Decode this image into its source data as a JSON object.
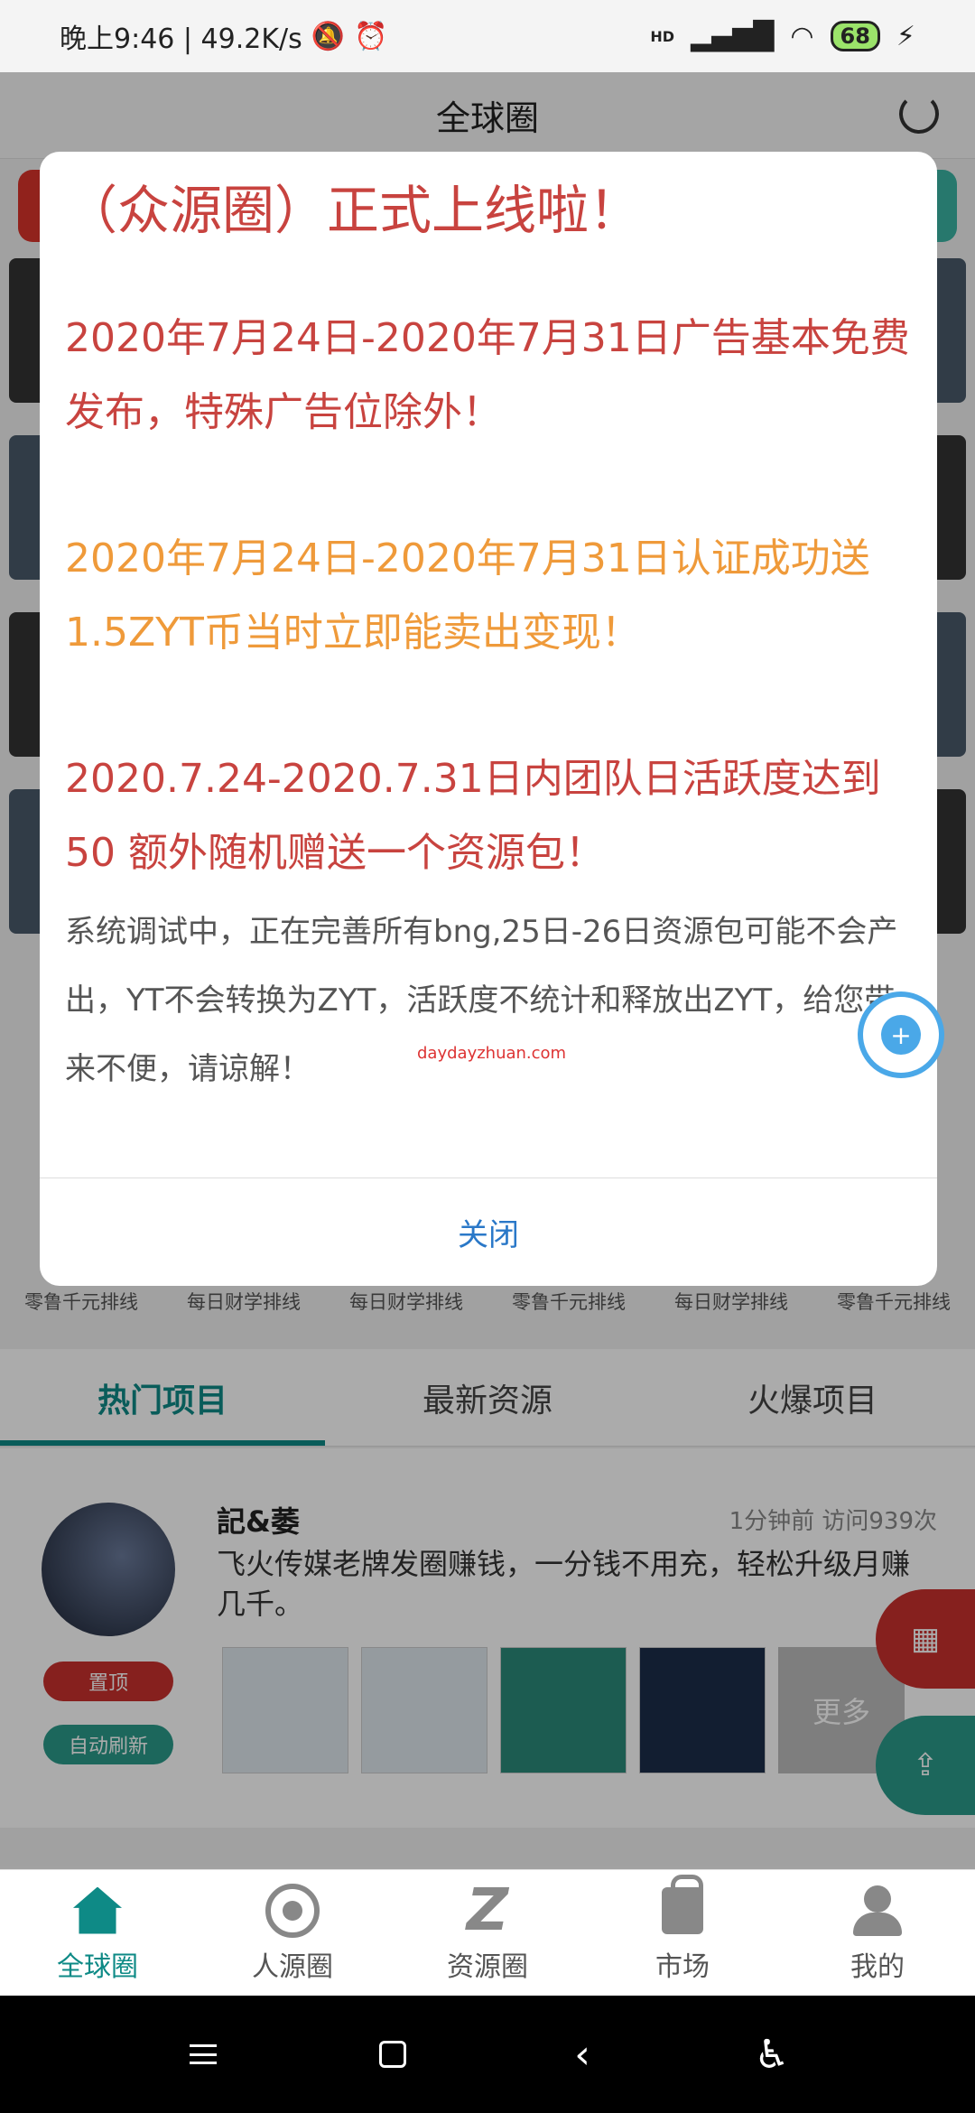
{
  "status_bar": {
    "time_speed": "晚上9:46 | 49.2K/s",
    "battery": "68",
    "signal_label": "HD"
  },
  "header": {
    "title": "全球圈"
  },
  "thumb_labels": [
    "零鲁千元排线",
    "每日财学排线",
    "每日财学排线",
    "零鲁千元排线",
    "每日财学排线",
    "零鲁千元排线"
  ],
  "tabs": [
    {
      "label": "热门项目",
      "active": true
    },
    {
      "label": "最新资源",
      "active": false
    },
    {
      "label": "火爆项目",
      "active": false
    }
  ],
  "post": {
    "author": "記&萎",
    "meta": "1分钟前   访问939次",
    "text": "飞火传媒老牌发圈赚钱，一分钱不用充，轻松升级月赚几千。",
    "pin_label": "置顶",
    "refresh_label": "自动刷新",
    "more_label": "更多"
  },
  "modal": {
    "title": "（众源圈）正式上线啦！",
    "para1": "2020年7月24日-2020年7月31日广告基本免费发布，特殊广告位除外！",
    "para2": "2020年7月24日-2020年7月31日认证成功送1.5ZYT币当时立即能卖出变现！",
    "para3": "2020.7.24-2020.7.31日内团队日活跃度达到50 额外随机赠送一个资源包！",
    "note": "系统调试中，正在完善所有bng,25日-26日资源包可能不会产出，YT不会转换为ZYT，活跃度不统计和释放出ZYT，给您带来不便，请谅解！",
    "watermark": "daydayzhuan.com",
    "close_label": "关闭"
  },
  "bottom_nav": [
    {
      "label": "全球圈",
      "active": true
    },
    {
      "label": "人源圈",
      "active": false
    },
    {
      "label": "资源圈",
      "active": false
    },
    {
      "label": "市场",
      "active": false
    },
    {
      "label": "我的",
      "active": false
    }
  ],
  "colors": {
    "accent": "#0e8a86",
    "modal_red": "#c8433f",
    "modal_orange": "#ef9a3a",
    "link_blue": "#2a78c8"
  }
}
